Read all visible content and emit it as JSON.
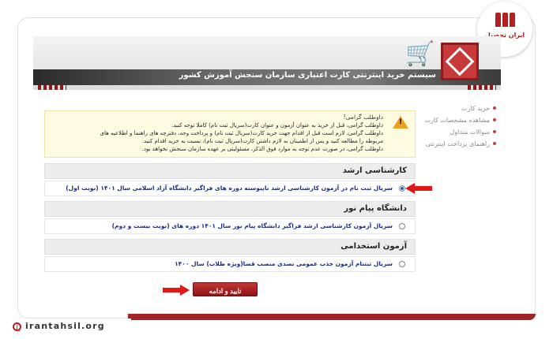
{
  "header": {
    "title": "سیستم خرید اینترنتی کارت اعتباری سازمان سنجش آموزش کشور"
  },
  "brand": {
    "name": "ایران تحصیل"
  },
  "sidebar": {
    "items": [
      {
        "label": "خرید کارت"
      },
      {
        "label": "مشاهده مشخصات کارت"
      },
      {
        "label": "سوالات متداول"
      },
      {
        "label": "راهنمای پرداخت اینترنتی"
      }
    ]
  },
  "notice": {
    "title": "داوطلب گرامی!",
    "lines": [
      "داوطلب گرامی، قبل از خرید به عنوان آزمون و عنوان کارت(سریال ثبت نام) کاملا توجه کنید.",
      "داوطلب گرامی، لازم است قبل از اقدام جهت خرید کارت(سریال ثبت نام) و پرداخت وجه، دفترچه های راهنما و اطلاعیه های",
      "مربوطه را مطالعه کنید و پس از اطمینان به لازم داشتن کارت(سریال ثبت نام)، نسبت به خرید اقدام کنید.",
      "داوطلب گرامی، در صورت عدم توجه به موارد فوق الذکر، مسئولیتی بر عهده سازمان سنجش نخواهد بود."
    ]
  },
  "sections": [
    {
      "title": "کارشناسی ارشد",
      "option": "سریال ثبت نام در آزمون کارشناسی ارشد ناپیوسته دوره های فراگیر دانشگاه آزاد اسلامی سال ۱۴۰۱ (نوبت اول)",
      "checked": true
    },
    {
      "title": "دانشگاه پیام نور",
      "option": "سریال آزمون کارشناسی ارشد فراگیر دانشگاه پیام نور سال ۱۴۰۱ دوره های (نوبت بیست و دوم)",
      "checked": false
    },
    {
      "title": "آزمون استخدامی",
      "option": "سریال ثبتنام آزمون جذب عمومی تصدی منصب قضا(ویژه طلاب) سال ۱۴۰۰",
      "checked": false
    }
  ],
  "confirm_label": "تایید و ادامه",
  "footer": {
    "url": "irantahsil.org"
  },
  "colors": {
    "accent": "#a32222",
    "arrow": "#e01818",
    "option_text": "#1c2b8a"
  }
}
